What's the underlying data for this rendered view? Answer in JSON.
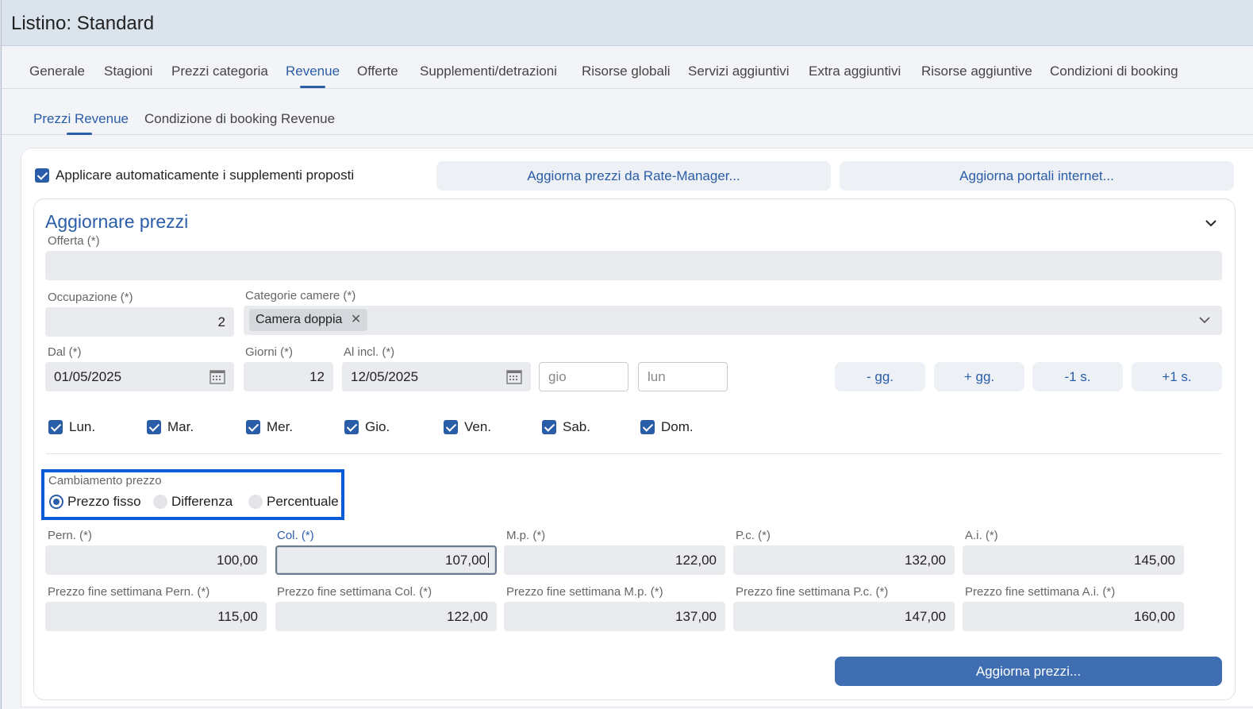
{
  "window": {
    "title": "Listino: Standard"
  },
  "main_tabs": [
    {
      "label": "Generale"
    },
    {
      "label": "Stagioni"
    },
    {
      "label": "Prezzi categoria"
    },
    {
      "label": "Revenue"
    },
    {
      "label": "Offerte"
    },
    {
      "label": "Supplementi/detrazioni"
    },
    {
      "label": "Risorse globali"
    },
    {
      "label": "Servizi aggiuntivi"
    },
    {
      "label": "Extra aggiuntivi"
    },
    {
      "label": "Risorse aggiuntive"
    },
    {
      "label": "Condizioni di booking"
    }
  ],
  "sub_tabs": [
    {
      "label": "Prezzi Revenue"
    },
    {
      "label": "Condizione di booking Revenue"
    }
  ],
  "top": {
    "auto_supplements_label": "Applicare automaticamente i supplementi proposti",
    "rate_manager_button": "Aggiorna prezzi da Rate-Manager...",
    "portals_button": "Aggiorna portali internet..."
  },
  "section": {
    "title": "Aggiornare prezzi",
    "offer_label": "Offerta (*)",
    "offer_value": "",
    "occupancy_label": "Occupazione (*)",
    "occupancy_value": "2",
    "categories_label": "Categorie camere (*)",
    "category_chip": "Camera doppia",
    "from_label": "Dal (*)",
    "from_value": "01/05/2025",
    "days_label": "Giorni (*)",
    "days_value": "12",
    "to_label": "Al incl. (*)",
    "to_value": "12/05/2025",
    "from_weekday_placeholder": "gio",
    "to_weekday_placeholder": "lun",
    "minus_day": "- gg.",
    "plus_day": "+ gg.",
    "minus_week": "-1 s.",
    "plus_week": "+1 s.",
    "weekdays": [
      {
        "label": "Lun."
      },
      {
        "label": "Mar."
      },
      {
        "label": "Mer."
      },
      {
        "label": "Gio."
      },
      {
        "label": "Ven."
      },
      {
        "label": "Sab."
      },
      {
        "label": "Dom."
      }
    ],
    "price_change_label": "Cambiamento prezzo",
    "price_change_options": [
      {
        "label": "Prezzo fisso",
        "selected": true
      },
      {
        "label": "Differenza",
        "selected": false
      },
      {
        "label": "Percentuale",
        "selected": false
      }
    ],
    "prices": [
      {
        "label": "Pern. (*)",
        "value": "100,00"
      },
      {
        "label": "Col. (*)",
        "value": "107,00"
      },
      {
        "label": "M.p. (*)",
        "value": "122,00"
      },
      {
        "label": "P.c. (*)",
        "value": "132,00"
      },
      {
        "label": "A.i. (*)",
        "value": "145,00"
      }
    ],
    "weekend_prices": [
      {
        "label": "Prezzo fine settimana Pern. (*)",
        "value": "115,00"
      },
      {
        "label": "Prezzo fine settimana Col. (*)",
        "value": "122,00"
      },
      {
        "label": "Prezzo fine settimana M.p. (*)",
        "value": "137,00"
      },
      {
        "label": "Prezzo fine settimana P.c. (*)",
        "value": "147,00"
      },
      {
        "label": "Prezzo fine settimana A.i. (*)",
        "value": "160,00"
      }
    ],
    "update_button": "Aggiorna prezzi..."
  },
  "colors": {
    "accent": "#2a5da8",
    "highlight_box": "#0a5bd6",
    "primary_button": "#3e6db1"
  }
}
